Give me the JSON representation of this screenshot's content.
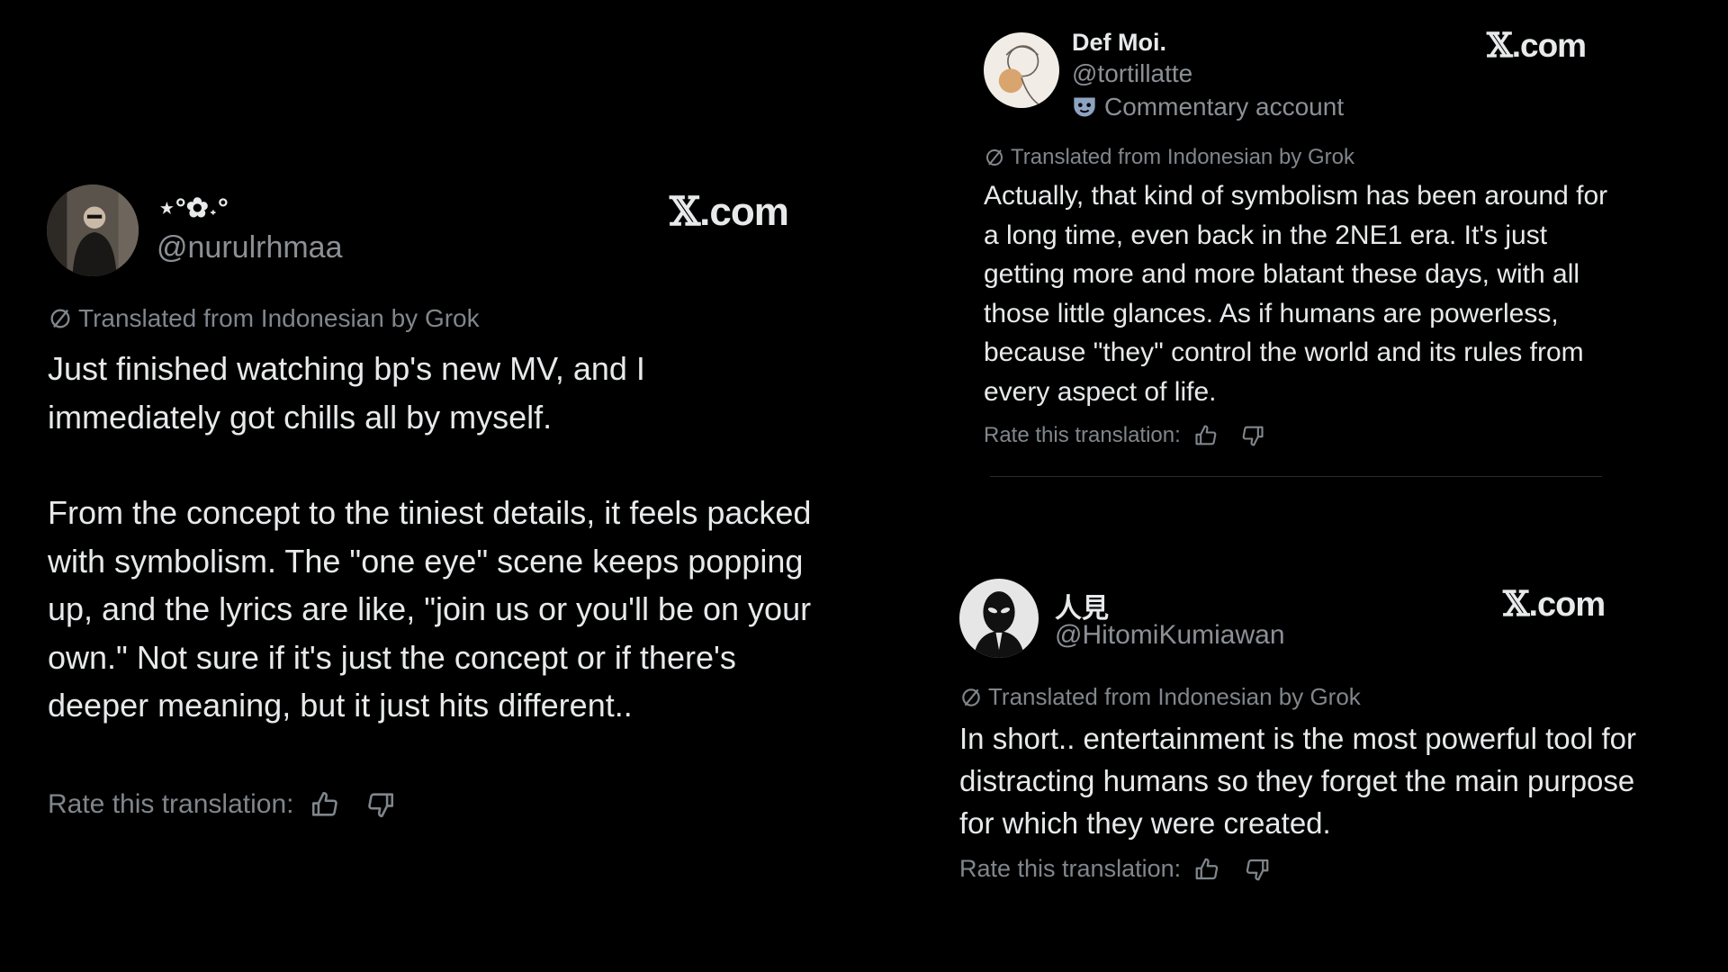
{
  "tweets": [
    {
      "name": "⋆°✿˖°",
      "handle": "@nurulrhmaa",
      "logo": ".com",
      "logo_x": "𝕏",
      "translated": "Translated from Indonesian by Grok",
      "paragraphs": [
        "Just finished watching bp's new MV, and I immediately got chills all by myself.",
        "From the concept to the tiniest details, it feels packed with symbolism. The \"one eye\" scene keeps popping up, and the lyrics are like, \"join us or you'll be on your own.\" Not sure if it's just the concept or if there's deeper meaning, but it just hits different.."
      ],
      "rate": "Rate this translation:",
      "icons": {
        "translate": "translate-icon",
        "like": "thumbs-up-icon",
        "dislike": "thumbs-down-icon"
      }
    },
    {
      "name": "Def Moi.",
      "handle": "@tortillatte",
      "commentary": "Commentary account",
      "logo": ".com",
      "logo_x": "𝕏",
      "translated": "Translated from Indonesian by Grok",
      "paragraphs": [
        "Actually, that kind of symbolism has been around for a long time, even back in the 2NE1 era. It's just getting more and more blatant these days, with all those little glances. As if humans are powerless, because \"they\" control the world and its rules from every aspect of life."
      ],
      "rate": "Rate this translation:",
      "icons": {
        "badge": "mask-icon",
        "translate": "translate-icon",
        "like": "thumbs-up-icon",
        "dislike": "thumbs-down-icon"
      }
    },
    {
      "name": "人見",
      "handle": "@HitomiKumiawan",
      "logo": ".com",
      "logo_x": "𝕏",
      "translated": "Translated from Indonesian by Grok",
      "paragraphs": [
        "In short.. entertainment is the most powerful tool for distracting humans so they forget the main purpose for which they were created."
      ],
      "rate": "Rate this translation:",
      "icons": {
        "translate": "translate-icon",
        "like": "thumbs-up-icon",
        "dislike": "thumbs-down-icon"
      }
    }
  ]
}
